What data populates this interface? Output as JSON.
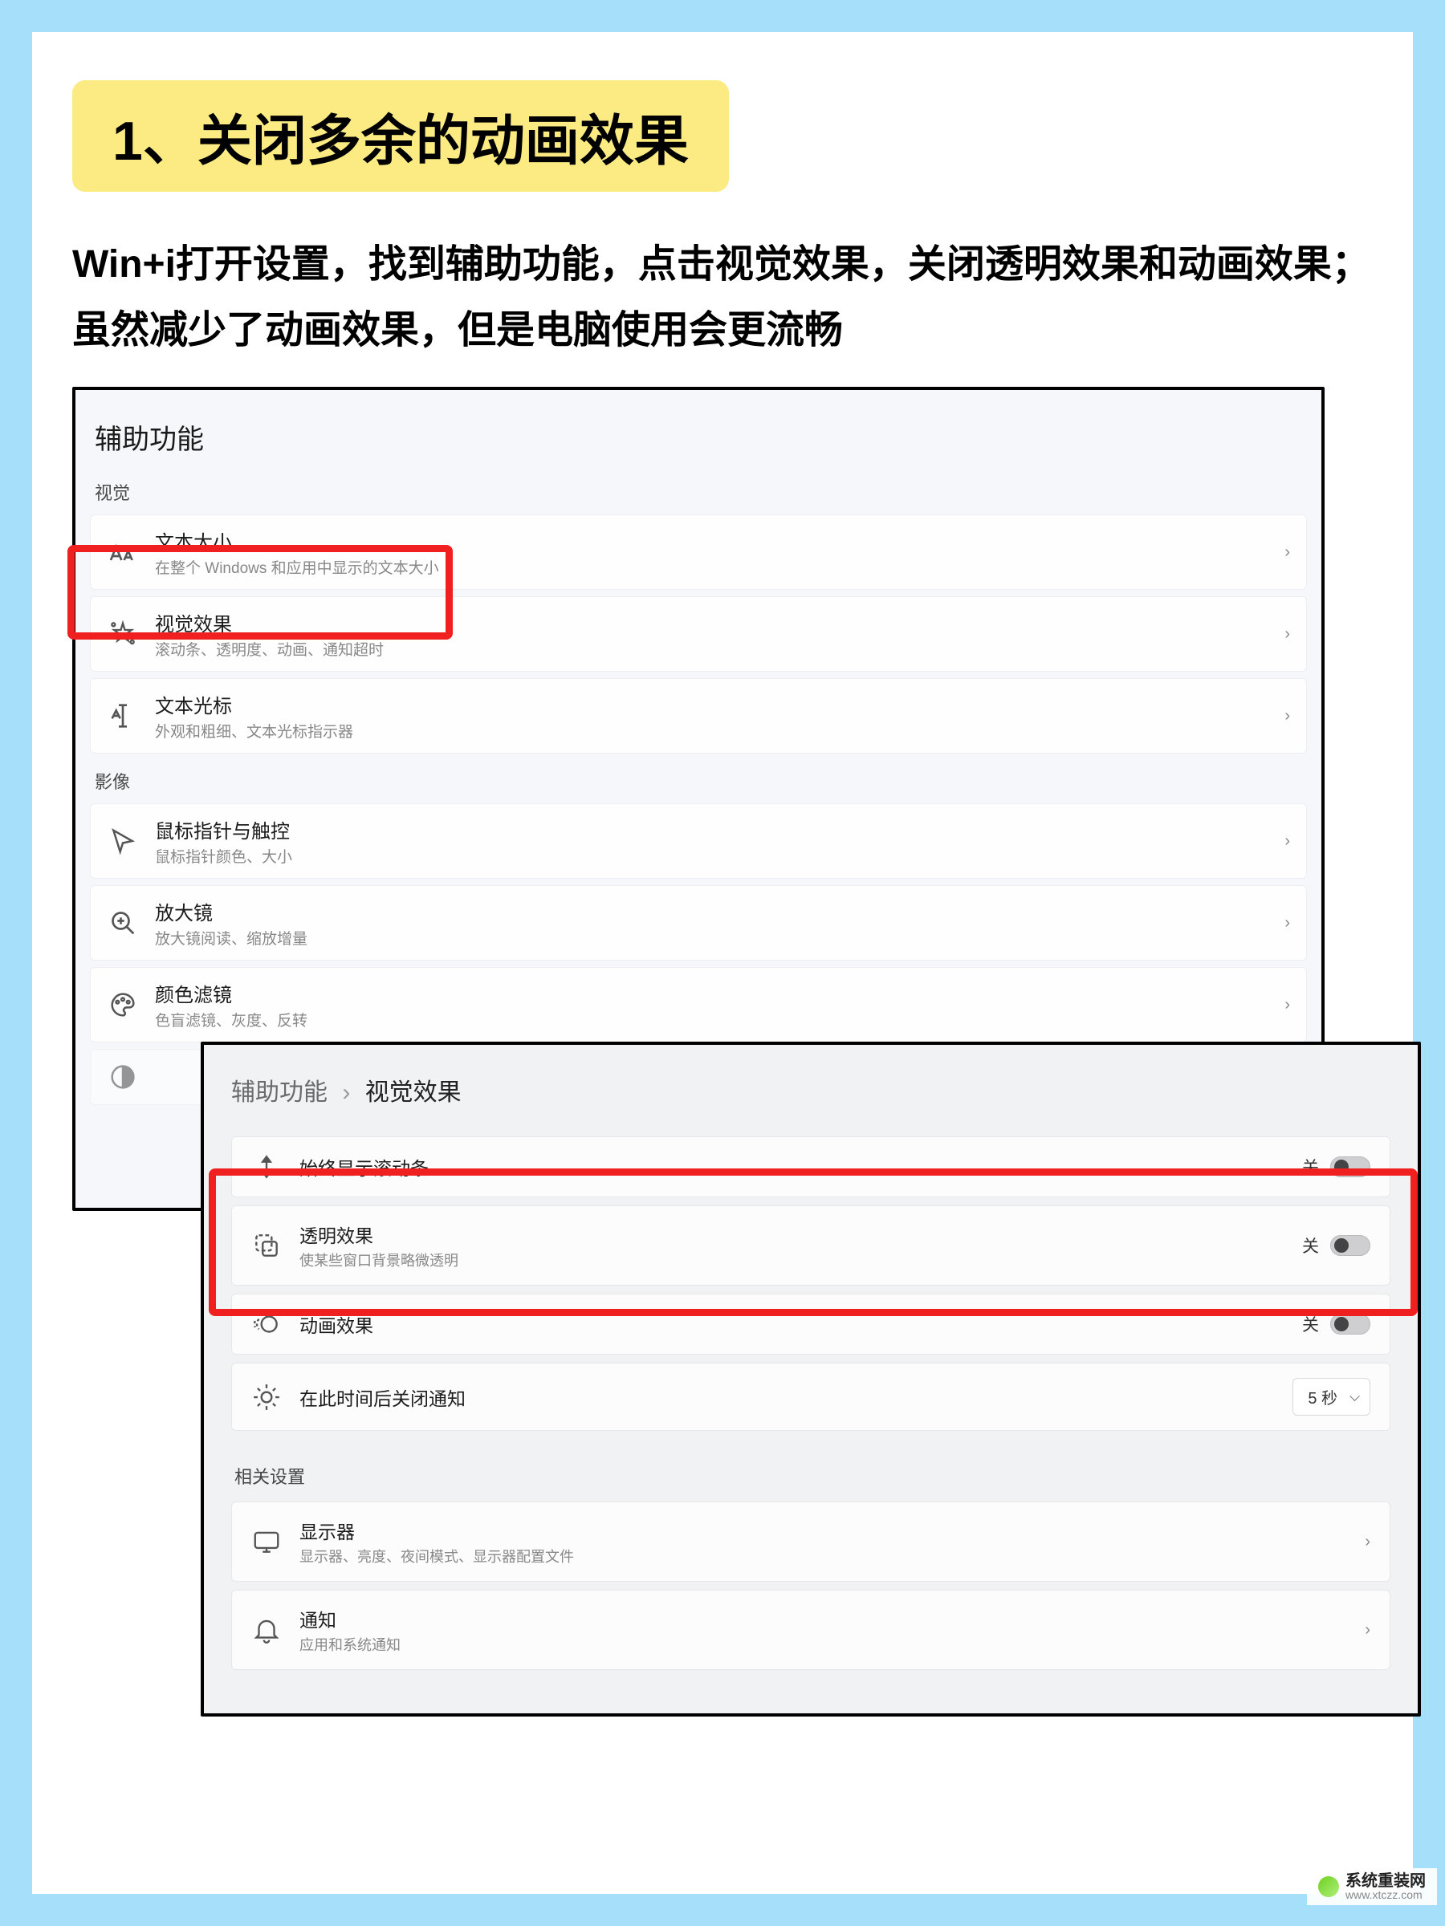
{
  "header": {
    "title": "1、关闭多余的动画效果",
    "intro": "Win+i打开设置，找到辅助功能，点击视觉效果，关闭透明效果和动画效果；虽然减少了动画效果，但是电脑使用会更流畅"
  },
  "panel1": {
    "title": "辅助功能",
    "section_vision": "视觉",
    "section_media": "影像",
    "items_vision": [
      {
        "icon": "text-size-icon",
        "title": "文本大小",
        "desc": "在整个 Windows 和应用中显示的文本大小"
      },
      {
        "icon": "visual-effects-icon",
        "title": "视觉效果",
        "desc": "滚动条、透明度、动画、通知超时"
      },
      {
        "icon": "text-cursor-icon",
        "title": "文本光标",
        "desc": "外观和粗细、文本光标指示器"
      }
    ],
    "items_media": [
      {
        "icon": "mouse-pointer-icon",
        "title": "鼠标指针与触控",
        "desc": "鼠标指针颜色、大小"
      },
      {
        "icon": "magnifier-icon",
        "title": "放大镜",
        "desc": "放大镜阅读、缩放增量"
      },
      {
        "icon": "color-filters-icon",
        "title": "颜色滤镜",
        "desc": "色盲滤镜、灰度、反转"
      }
    ]
  },
  "panel2": {
    "breadcrumb_root": "辅助功能",
    "breadcrumb_sep": "›",
    "breadcrumb_leaf": "视觉效果",
    "toggles": [
      {
        "icon": "scrollbar-icon",
        "title": "始终显示滚动条",
        "desc": "",
        "state": "关"
      },
      {
        "icon": "transparency-icon",
        "title": "透明效果",
        "desc": "使某些窗口背景略微透明",
        "state": "关"
      },
      {
        "icon": "animation-icon",
        "title": "动画效果",
        "desc": "",
        "state": "关"
      }
    ],
    "timeout": {
      "icon": "brightness-icon",
      "title": "在此时间后关闭通知",
      "value": "5 秒"
    },
    "related_label": "相关设置",
    "related": [
      {
        "icon": "display-icon",
        "title": "显示器",
        "desc": "显示器、亮度、夜间模式、显示器配置文件"
      },
      {
        "icon": "notifications-icon",
        "title": "通知",
        "desc": "应用和系统通知"
      }
    ]
  },
  "footer": {
    "name": "系统重装网",
    "url": "www.xtczz.com"
  }
}
